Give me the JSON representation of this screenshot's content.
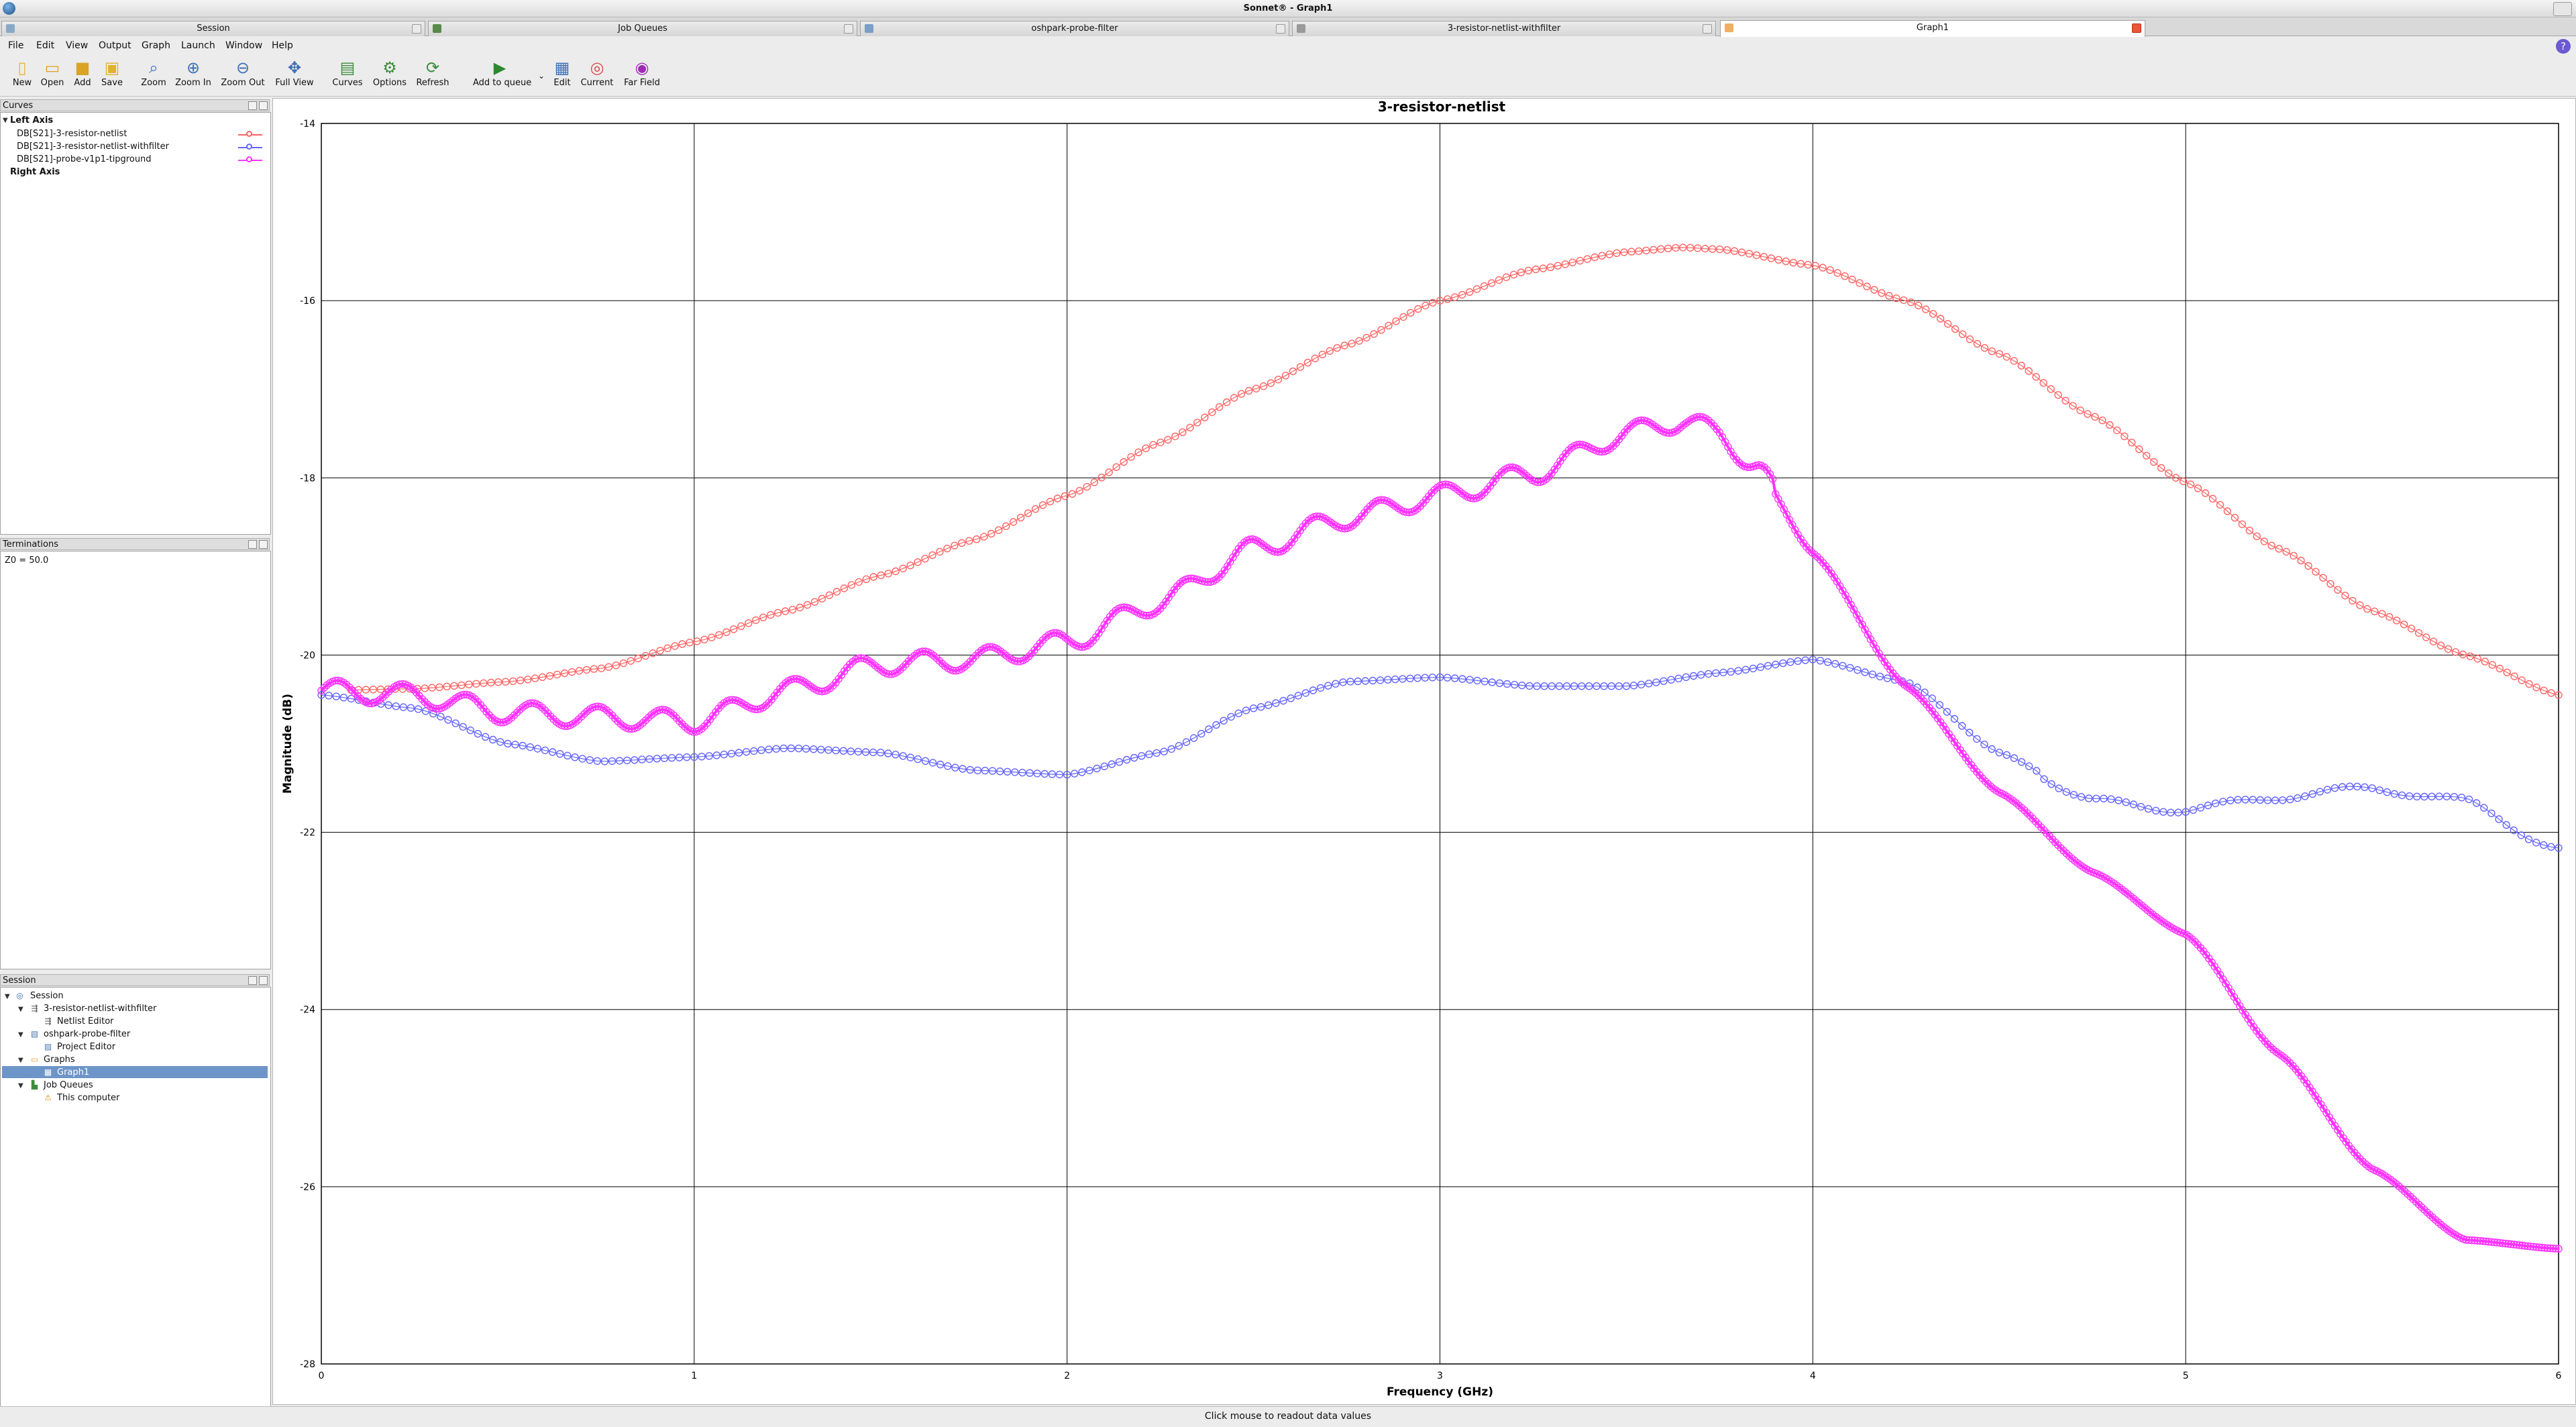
{
  "window": {
    "title": "Sonnet® - Graph1"
  },
  "tabs": [
    {
      "label": "Session"
    },
    {
      "label": "Job Queues"
    },
    {
      "label": "oshpark-probe-filter"
    },
    {
      "label": "3-resistor-netlist-withfilter"
    },
    {
      "label": "Graph1",
      "active": true
    }
  ],
  "menu": [
    "File",
    "Edit",
    "View",
    "Output",
    "Graph",
    "Launch",
    "Window",
    "Help"
  ],
  "toolbar": [
    {
      "label": "New",
      "icon": "new-file-icon"
    },
    {
      "label": "Open",
      "icon": "open-folder-icon"
    },
    {
      "label": "Add",
      "icon": "add-icon"
    },
    {
      "label": "Save",
      "icon": "save-icon"
    },
    {
      "label": "Zoom",
      "icon": "zoom-icon"
    },
    {
      "label": "Zoom In",
      "icon": "zoom-in-icon"
    },
    {
      "label": "Zoom Out",
      "icon": "zoom-out-icon"
    },
    {
      "label": "Full View",
      "icon": "full-view-icon"
    },
    {
      "label": "Curves",
      "icon": "curves-icon"
    },
    {
      "label": "Options",
      "icon": "options-icon"
    },
    {
      "label": "Refresh",
      "icon": "refresh-icon"
    },
    {
      "label": "Add to queue",
      "icon": "add-to-queue-icon"
    },
    {
      "label": "Edit",
      "icon": "edit-icon"
    },
    {
      "label": "Current",
      "icon": "current-icon"
    },
    {
      "label": "Far Field",
      "icon": "far-field-icon"
    }
  ],
  "curves_panel": {
    "title": "Curves",
    "left_axis": "Left Axis",
    "curves": [
      {
        "label": "DB[S21]-3-resistor-netlist",
        "color": "#ff6464"
      },
      {
        "label": "DB[S21]-3-resistor-netlist-withfilter",
        "color": "#6464ff"
      },
      {
        "label": "DB[S21]-probe-v1p1-tipground",
        "color": "#ff32ff"
      }
    ],
    "right_axis": "Right Axis"
  },
  "terminations_panel": {
    "title": "Terminations",
    "text": "Z0 = 50.0"
  },
  "session_panel": {
    "title": "Session",
    "tree": [
      {
        "label": "Session",
        "level": 0,
        "icon": "session-icon"
      },
      {
        "label": "3-resistor-netlist-withfilter",
        "level": 1,
        "icon": "netlist-icon"
      },
      {
        "label": "Netlist Editor",
        "level": 2,
        "icon": "netlist-editor-icon"
      },
      {
        "label": "oshpark-probe-filter",
        "level": 1,
        "icon": "project-icon"
      },
      {
        "label": "Project Editor",
        "level": 2,
        "icon": "project-editor-icon"
      },
      {
        "label": "Graphs",
        "level": 1,
        "icon": "folder-icon"
      },
      {
        "label": "Graph1",
        "level": 2,
        "icon": "graph-icon",
        "selected": true
      },
      {
        "label": "Job Queues",
        "level": 1,
        "icon": "job-queues-icon"
      },
      {
        "label": "This computer",
        "level": 2,
        "icon": "warning-icon"
      }
    ]
  },
  "status": "Click mouse to readout data values",
  "chart_data": {
    "type": "scatter",
    "title": "3-resistor-netlist",
    "xlabel": "Frequency (GHz)",
    "ylabel": "Magnitude (dB)",
    "xlim": [
      0,
      6
    ],
    "ylim": [
      -28,
      -14
    ],
    "x_ticks": [
      "0",
      "1",
      "2",
      "3",
      "4",
      "5",
      "6"
    ],
    "y_ticks": [
      "-28",
      "-26",
      "-24",
      "-22",
      "-20",
      "-18",
      "-16",
      "-14"
    ],
    "grid": true,
    "series": [
      {
        "name": "DB[S21]-3-resistor-netlist",
        "color": "#ff6464",
        "x": [
          0,
          0.25,
          0.5,
          0.75,
          1,
          1.25,
          1.5,
          1.75,
          2,
          2.25,
          2.5,
          2.75,
          3,
          3.25,
          3.5,
          3.65,
          3.75,
          4,
          4.25,
          4.5,
          4.75,
          5,
          5.25,
          5.5,
          5.75,
          6
        ],
        "y": [
          -20.4,
          -20.38,
          -20.3,
          -20.15,
          -19.85,
          -19.5,
          -19.1,
          -18.7,
          -18.2,
          -17.6,
          -17.0,
          -16.5,
          -16.0,
          -15.65,
          -15.45,
          -15.4,
          -15.42,
          -15.6,
          -16.0,
          -16.6,
          -17.3,
          -18.05,
          -18.8,
          -19.5,
          -20.0,
          -20.45
        ]
      },
      {
        "name": "DB[S21]-3-resistor-netlist-withfilter",
        "color": "#6464ff",
        "x": [
          0,
          0.25,
          0.5,
          0.75,
          1,
          1.25,
          1.5,
          1.75,
          2,
          2.25,
          2.5,
          2.75,
          3,
          3.25,
          3.5,
          3.75,
          4,
          4.25,
          4.5,
          4.75,
          5,
          5.25,
          5.5,
          5.75,
          6
        ],
        "y": [
          -20.45,
          -20.6,
          -21.0,
          -21.2,
          -21.15,
          -21.05,
          -21.1,
          -21.3,
          -21.35,
          -21.1,
          -20.6,
          -20.3,
          -20.25,
          -20.35,
          -20.35,
          -20.2,
          -20.05,
          -20.3,
          -21.1,
          -21.65,
          -21.75,
          -21.6,
          -21.5,
          -21.65,
          -22.2
        ]
      },
      {
        "name": "DB[S21]-probe-v1p1-tipground",
        "color": "#ff32ff",
        "x": [
          0,
          0.25,
          0.5,
          0.75,
          1,
          1.25,
          1.5,
          1.75,
          2,
          2.25,
          2.5,
          2.75,
          3,
          3.25,
          3.5,
          3.65,
          3.75,
          3.85,
          4,
          4.25,
          4.5,
          4.75,
          5,
          5.25,
          5.5,
          5.75,
          6
        ],
        "y": [
          -20.4,
          -20.45,
          -20.65,
          -20.7,
          -20.75,
          -20.4,
          -20.1,
          -20.05,
          -19.85,
          -19.4,
          -18.8,
          -18.45,
          -18.2,
          -17.95,
          -17.5,
          -17.35,
          -17.5,
          -17.9,
          -18.85,
          -20.35,
          -21.55,
          -22.45,
          -23.15,
          -24.5,
          -25.8,
          -26.6,
          -26.7
        ]
      }
    ]
  }
}
